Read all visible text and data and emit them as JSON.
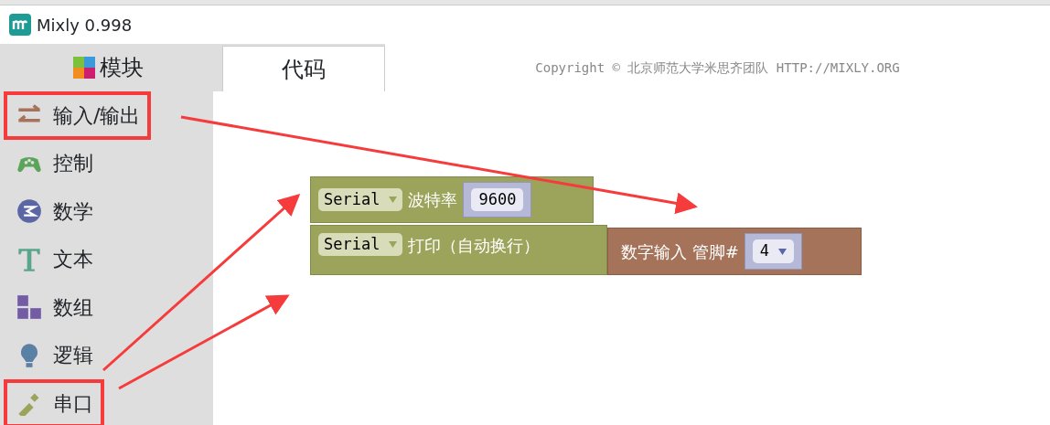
{
  "window": {
    "title": "Mixly 0.998"
  },
  "sidebar": {
    "header": "模块",
    "items": [
      {
        "label": "输入/输出",
        "kind": "io",
        "highlighted": true
      },
      {
        "label": "控制",
        "kind": "control",
        "highlighted": false
      },
      {
        "label": "数学",
        "kind": "math",
        "highlighted": false
      },
      {
        "label": "文本",
        "kind": "text",
        "highlighted": false
      },
      {
        "label": "数组",
        "kind": "array",
        "highlighted": false
      },
      {
        "label": "逻辑",
        "kind": "logic",
        "highlighted": false
      },
      {
        "label": "串口",
        "kind": "serial",
        "highlighted": true
      }
    ]
  },
  "tabs": [
    {
      "label": "代码",
      "selected": true
    }
  ],
  "copyright": "Copyright © 北京师范大学米思齐团队 HTTP://MIXLY.ORG",
  "blocks": [
    {
      "kind": "serial_begin",
      "port": "Serial",
      "label": "波特率",
      "value": "9600"
    },
    {
      "kind": "serial_println",
      "port": "Serial",
      "label": "打印（自动换行）",
      "input": {
        "label": "数字输入 管脚#",
        "value": "4"
      }
    }
  ]
}
